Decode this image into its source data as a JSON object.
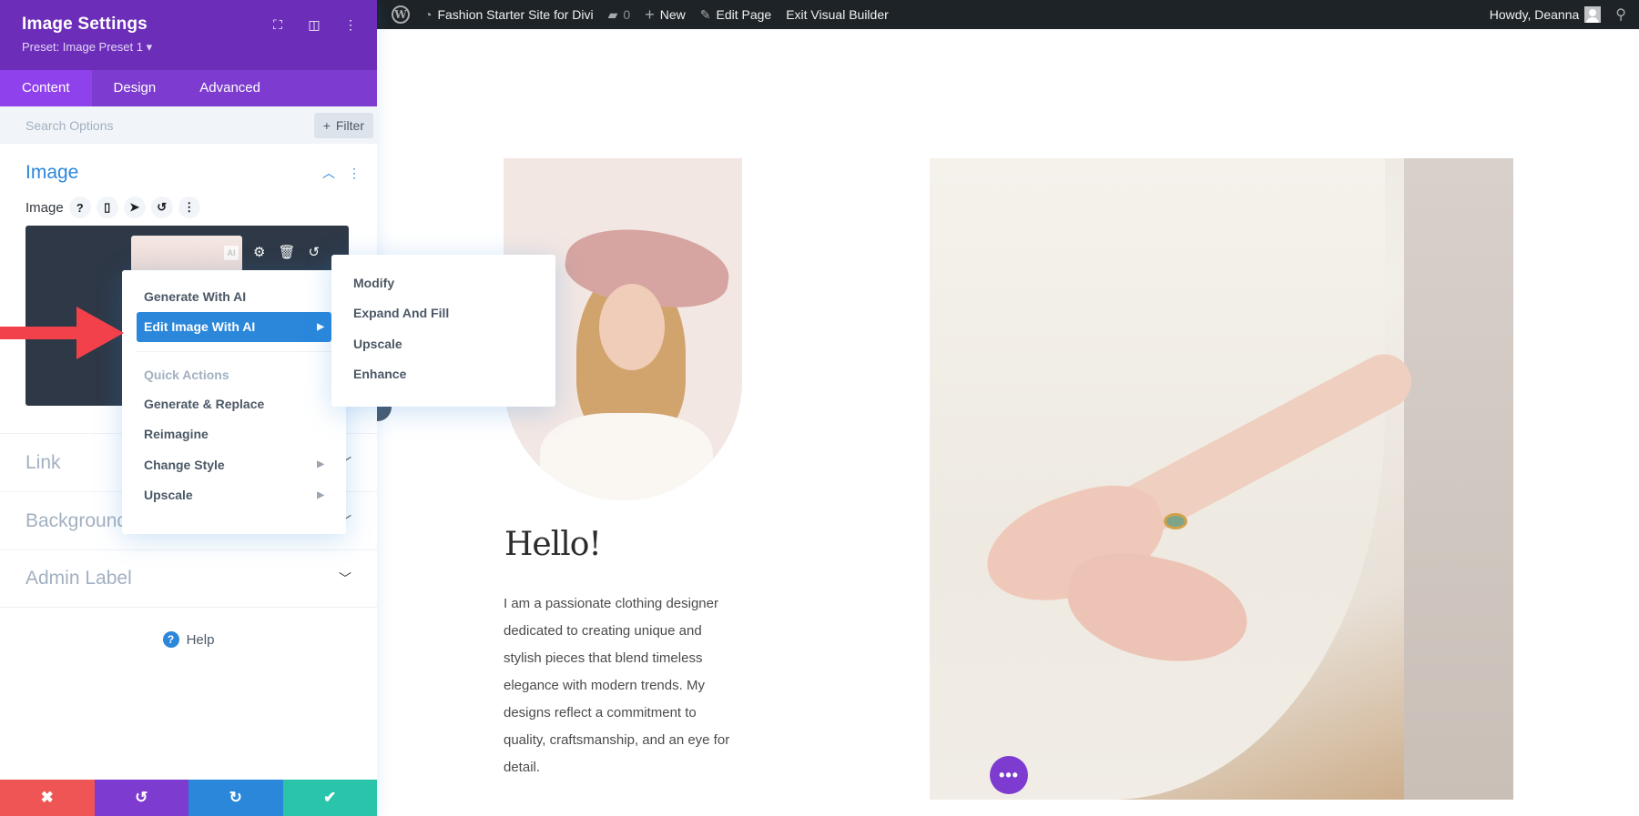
{
  "admin_bar": {
    "site_name": "Fashion Starter Site for Divi",
    "comments_count": "0",
    "new_label": "New",
    "edit_page_label": "Edit Page",
    "exit_builder_label": "Exit Visual Builder",
    "greeting": "Howdy, Deanna"
  },
  "panel": {
    "title": "Image Settings",
    "preset": "Preset: Image Preset 1 ▾",
    "tabs": [
      {
        "label": "Content",
        "active": true
      },
      {
        "label": "Design",
        "active": false
      },
      {
        "label": "Advanced",
        "active": false
      }
    ],
    "search_placeholder": "Search Options",
    "filter_label": "Filter",
    "section_title": "Image",
    "field_label": "Image",
    "collapsed_sections": [
      {
        "label": "Link"
      },
      {
        "label": "Background"
      },
      {
        "label": "Admin Label"
      }
    ],
    "help_label": "Help"
  },
  "context_menu": {
    "items": [
      {
        "label": "Generate With AI",
        "submenu": false,
        "active": false
      },
      {
        "label": "Edit Image With AI",
        "submenu": true,
        "active": true
      }
    ],
    "section_header": "Quick Actions",
    "quick_actions": [
      {
        "label": "Generate & Replace",
        "submenu": false
      },
      {
        "label": "Reimagine",
        "submenu": false
      },
      {
        "label": "Change Style",
        "submenu": true
      },
      {
        "label": "Upscale",
        "submenu": true
      }
    ]
  },
  "submenu": {
    "items": [
      {
        "label": "Modify"
      },
      {
        "label": "Expand And Fill"
      },
      {
        "label": "Upscale"
      },
      {
        "label": "Enhance"
      }
    ]
  },
  "page": {
    "heading": "Hello!",
    "bio": "I am a passionate clothing designer dedicated to creating unique and stylish pieces that blend timeless elegance with modern trends. My designs reflect a commitment to quality, craftsmanship, and an eye for detail."
  },
  "colors": {
    "header_purple": "#6c2eb9",
    "tab_purple": "#7d3bcf",
    "accent_blue": "#2b87da",
    "cancel_red": "#ef5555",
    "undo_purple": "#7e3bd0",
    "redo_blue": "#2b87da",
    "save_green": "#29c4a9"
  }
}
